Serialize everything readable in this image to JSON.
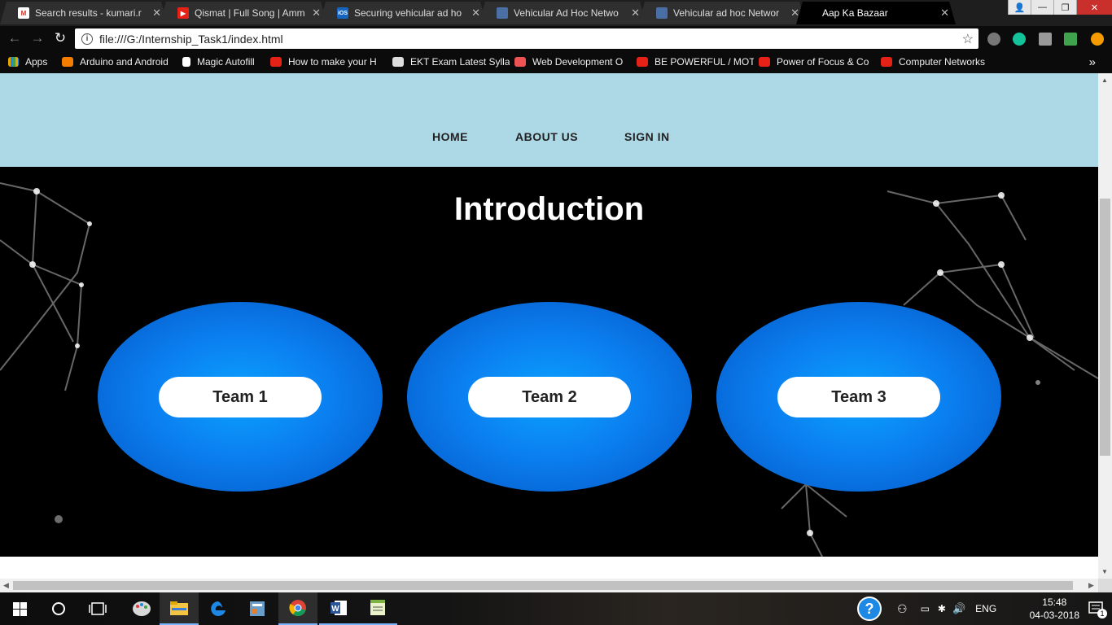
{
  "browser": {
    "tabs": [
      {
        "title": "Search results - kumari.r",
        "icon": "gmail-icon",
        "color": "#d93025",
        "active": false
      },
      {
        "title": "Qismat | Full Song | Amm",
        "icon": "youtube-icon",
        "color": "#e62117",
        "active": false
      },
      {
        "title": "Securing vehicular ad ho",
        "icon": "ios-icon",
        "color": "#1565c0",
        "active": false
      },
      {
        "title": "Vehicular Ad Hoc Netwo",
        "icon": "document-icon",
        "color": "#4a6fa5",
        "active": false
      },
      {
        "title": "Vehicular ad hoc Networ",
        "icon": "document-icon",
        "color": "#4a6fa5",
        "active": false
      },
      {
        "title": "Aap Ka Bazaar",
        "icon": "",
        "color": "",
        "active": true
      }
    ],
    "address": "file:///G:/Internship_Task1/index.html",
    "ios_label": "iOS"
  },
  "bookmarks": [
    {
      "label": "Apps",
      "icon": "apps-grid-icon",
      "color": "#e8a400"
    },
    {
      "label": "Arduino and Android",
      "icon": "blogger-icon",
      "color": "#f57d00"
    },
    {
      "label": "Magic Autofill",
      "icon": "page-icon",
      "color": "#ffffff"
    },
    {
      "label": "How to make your H",
      "icon": "youtube-icon",
      "color": "#e62117"
    },
    {
      "label": "EKT Exam Latest Sylla",
      "icon": "ekt-icon",
      "color": "#dddddd"
    },
    {
      "label": "Web Development O",
      "icon": "udemy-icon",
      "color": "#ec5252"
    },
    {
      "label": "BE POWERFUL / MOT",
      "icon": "youtube-icon",
      "color": "#e62117"
    },
    {
      "label": "Power of Focus & Co",
      "icon": "youtube-icon",
      "color": "#e62117"
    },
    {
      "label": "Computer Networks",
      "icon": "youtube-icon",
      "color": "#e62117"
    }
  ],
  "site": {
    "nav": {
      "home": "HOME",
      "about": "ABOUT US",
      "signin": "SIGN IN"
    },
    "intro_title": "Introduction",
    "teams": [
      {
        "label": "Team 1"
      },
      {
        "label": "Team 2"
      },
      {
        "label": "Team 3"
      }
    ]
  },
  "taskbar": {
    "language": "ENG",
    "time": "15:48",
    "date": "04-03-2018",
    "notification_count": "1"
  }
}
